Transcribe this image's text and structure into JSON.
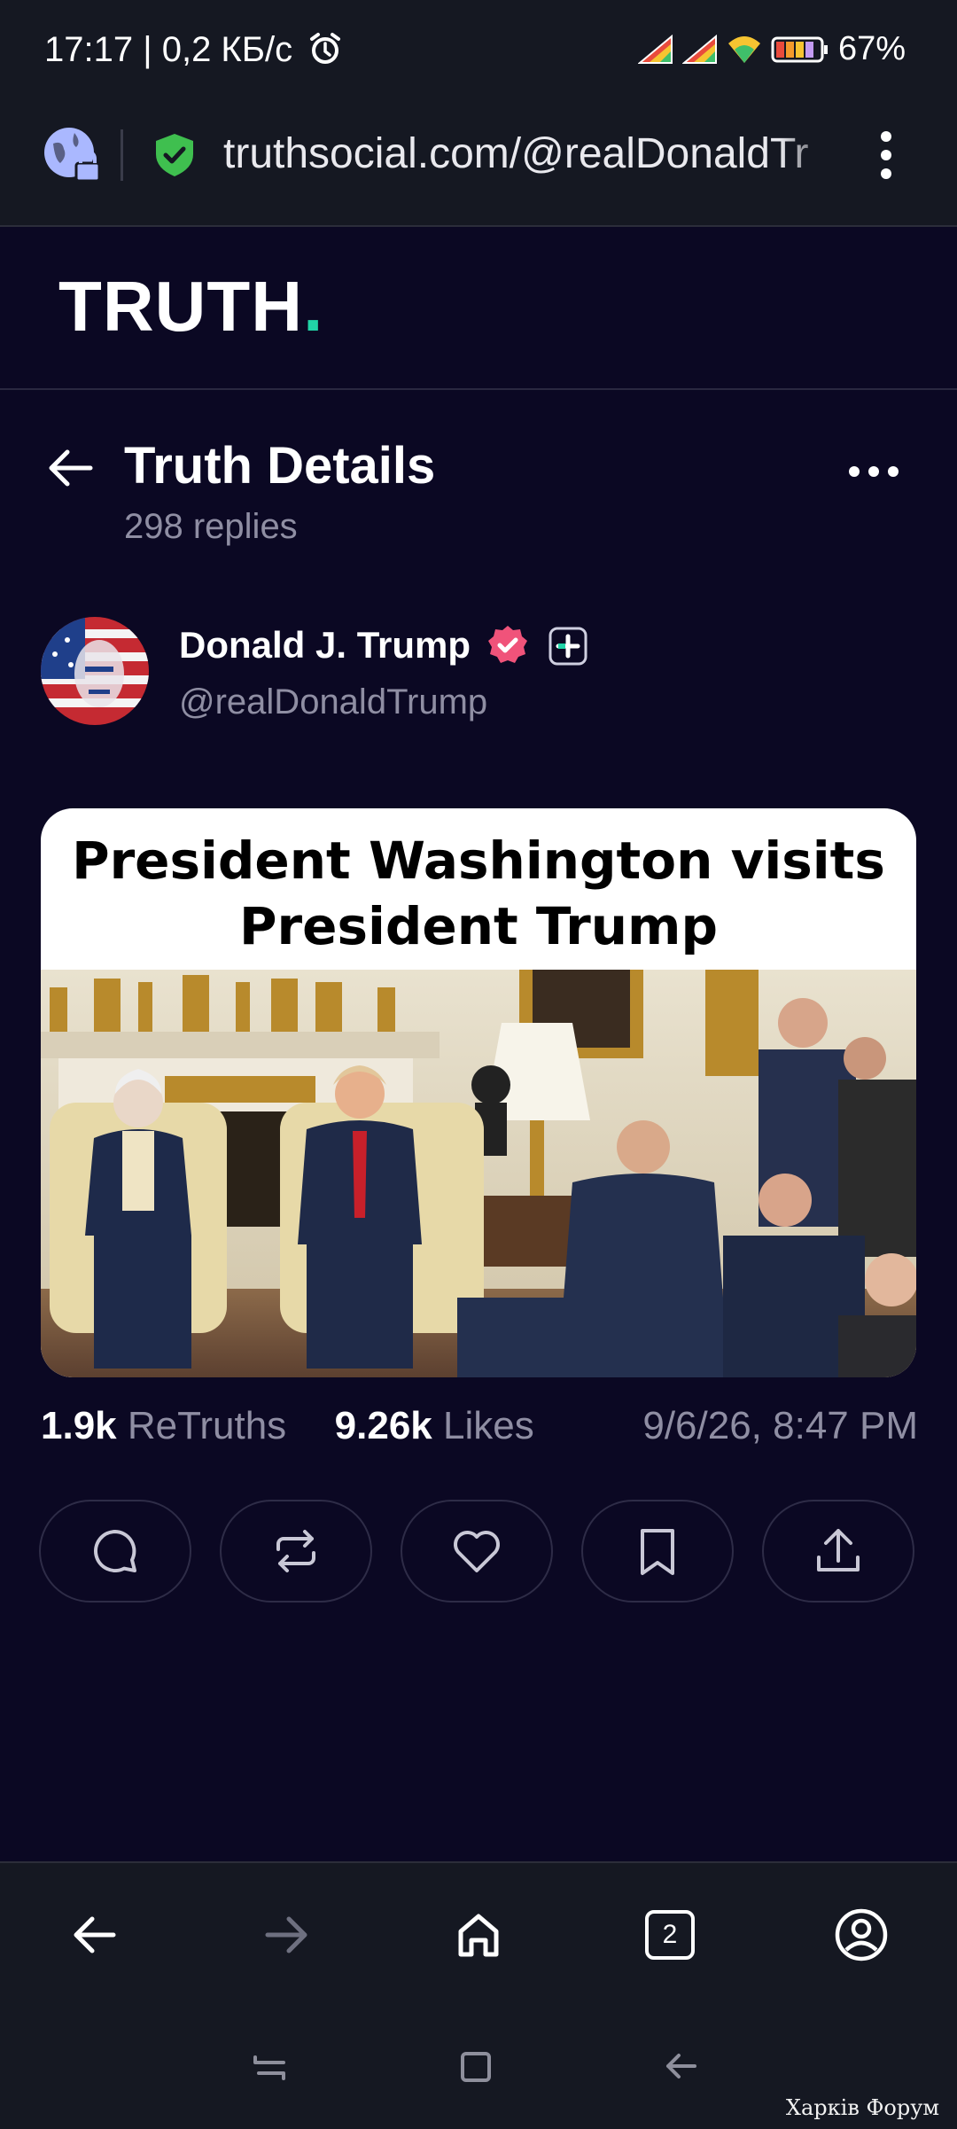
{
  "status_bar": {
    "time_speed": "17:17 | 0,2 КБ/с",
    "battery_percent": "67%"
  },
  "browser": {
    "url": "truthsocial.com/@realDonaldTr"
  },
  "app": {
    "logo_text": "TRUTH",
    "logo_dot": "."
  },
  "details": {
    "title": "Truth Details",
    "replies": "298 replies"
  },
  "author": {
    "name": "Donald J. Trump",
    "handle": "@realDonaldTrump"
  },
  "post": {
    "image_headline_line1": "President Washington visits",
    "image_headline_line2": "President Trump"
  },
  "stats": {
    "retruths_count": "1.9k",
    "retruths_label": "ReTruths",
    "likes_count": "9.26k",
    "likes_label": "Likes",
    "timestamp": "9/6/26, 8:47 PM"
  },
  "bottom_nav": {
    "tab_count": "2"
  },
  "watermark": "Харків Форум",
  "colors": {
    "background": "#0b0823",
    "bar": "#151822",
    "accent": "#21d4a7",
    "verified": "#f0537a",
    "muted_text": "#8f8ea3"
  }
}
